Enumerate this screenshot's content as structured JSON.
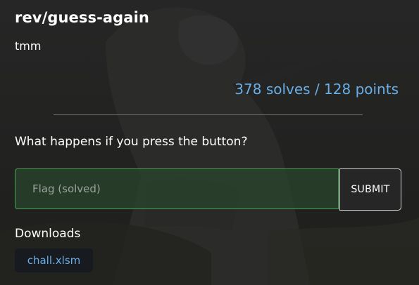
{
  "challenge": {
    "title": "rev/guess-again",
    "author": "tmm",
    "solves_points": "378 solves / 128 points",
    "description": "What happens if you press the button?"
  },
  "flag_form": {
    "placeholder": "Flag (solved)",
    "value": "",
    "submit_label": "SUBMIT"
  },
  "downloads": {
    "label": "Downloads",
    "files": [
      {
        "name": "chall.xlsm"
      }
    ]
  },
  "colors": {
    "accent": "#6aaee6",
    "success_border": "#43a253",
    "card_background": "#222222"
  }
}
